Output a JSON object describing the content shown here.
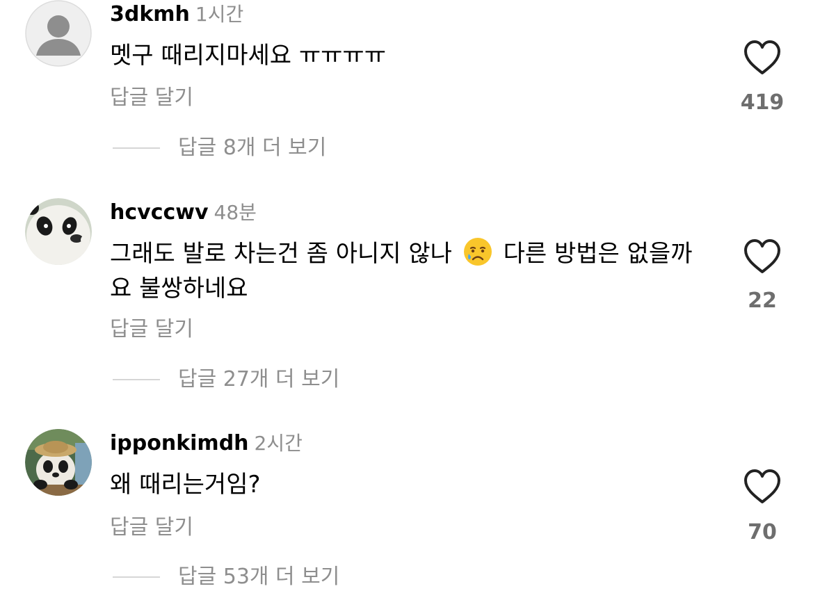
{
  "comments": [
    {
      "username": "3dkmh",
      "time": "1시간",
      "text": "멧구 때리지마세요 ㅠㅠㅠㅠ",
      "reply_label": "답글 달기",
      "likes": "419",
      "view_replies": "답글 8개 더 보기",
      "avatar": "default-avatar-icon"
    },
    {
      "username": "hcvccwv",
      "time": "48분",
      "text_part1": "그래도 발로 차는건 좀 아니지 않나",
      "emoji": "crying-face-emoji",
      "text_part2": "다른 방법은 없을까요 불쌍하네요",
      "reply_label": "답글 달기",
      "likes": "22",
      "view_replies": "답글 27개 더 보기",
      "avatar": "panda-avatar-icon"
    },
    {
      "username": "ipponkimdh",
      "time": "2시간",
      "text": "왜 때리는거임?",
      "reply_label": "답글 달기",
      "likes": "70",
      "view_replies": "답글 53개 더 보기",
      "avatar": "panda-hat-avatar-icon"
    }
  ],
  "colors": {
    "primary_text": "#000000",
    "secondary_text": "#8e8e8e",
    "like_count": "#6e6e6e",
    "divider_line": "#d6d6d6"
  },
  "icons": {
    "like": "heart-outline-icon"
  }
}
